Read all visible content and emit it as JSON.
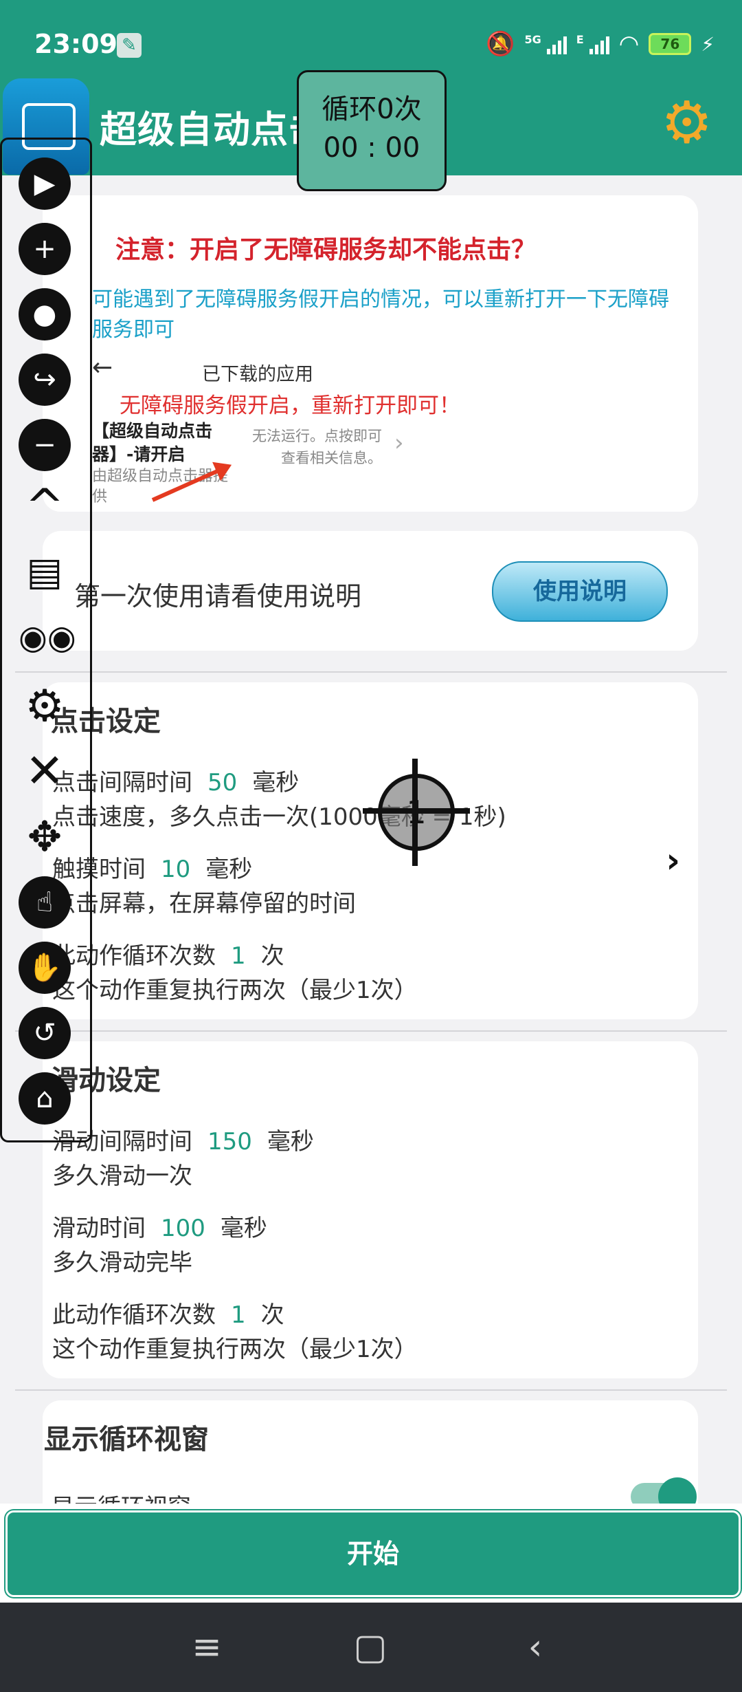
{
  "status_bar": {
    "time": "23:09",
    "battery": "76",
    "network": "5G",
    "network2": "E"
  },
  "app": {
    "title": "超级自动点击器"
  },
  "loop_overlay": {
    "count_text": "循环0次",
    "timer_text": "00 : 00"
  },
  "notice": {
    "title": "注意：开启了无障碍服务却不能点击？",
    "body": "可能遇到了无障碍服务假开启的情况，可以重新打开一下无障碍服务即可",
    "demo": {
      "back": "←",
      "header": "已下载的应用",
      "red_caption": "无障碍服务假开启，重新打开即可！",
      "app_name": "【超级自动点击器】-请开启",
      "app_sub": "由超级自动点击器提供",
      "info": "无法运行。点按即可查看相关信息。"
    }
  },
  "guide": {
    "text": "第一次使用请看使用说明",
    "button_label": "使用说明"
  },
  "click_settings": {
    "title": "点击设定",
    "interval": {
      "label": "点击间隔时间",
      "value": "50",
      "unit": "毫秒",
      "desc": "点击速度，多久点击一次(1000毫秒 = 1秒)"
    },
    "touch": {
      "label": "触摸时间",
      "value": "10",
      "unit": "毫秒",
      "desc": "点击屏幕，在屏幕停留的时间"
    },
    "loops": {
      "label": "此动作循环次数",
      "value": "1",
      "unit": "次",
      "desc": "这个动作重复执行两次（最少1次）"
    }
  },
  "swipe_settings": {
    "title": "滑动设定",
    "interval": {
      "label": "滑动间隔时间",
      "value": "150",
      "unit": "毫秒",
      "desc": "多久滑动一次"
    },
    "duration": {
      "label": "滑动时间",
      "value": "100",
      "unit": "毫秒",
      "desc": "多久滑动完毕"
    },
    "loops": {
      "label": "此动作循环次数",
      "value": "1",
      "unit": "次",
      "desc": "这个动作重复执行两次（最少1次）"
    }
  },
  "loop_window": {
    "title": "显示循环视窗",
    "toggle_label": "显示循环视窗",
    "enabled": true
  },
  "start_button": "开始",
  "crosshair_label": "1",
  "colors": {
    "primary": "#1f9b80",
    "accent_gear": "#f2a92a",
    "warning": "#d4232c",
    "info": "#1aa0c8"
  }
}
